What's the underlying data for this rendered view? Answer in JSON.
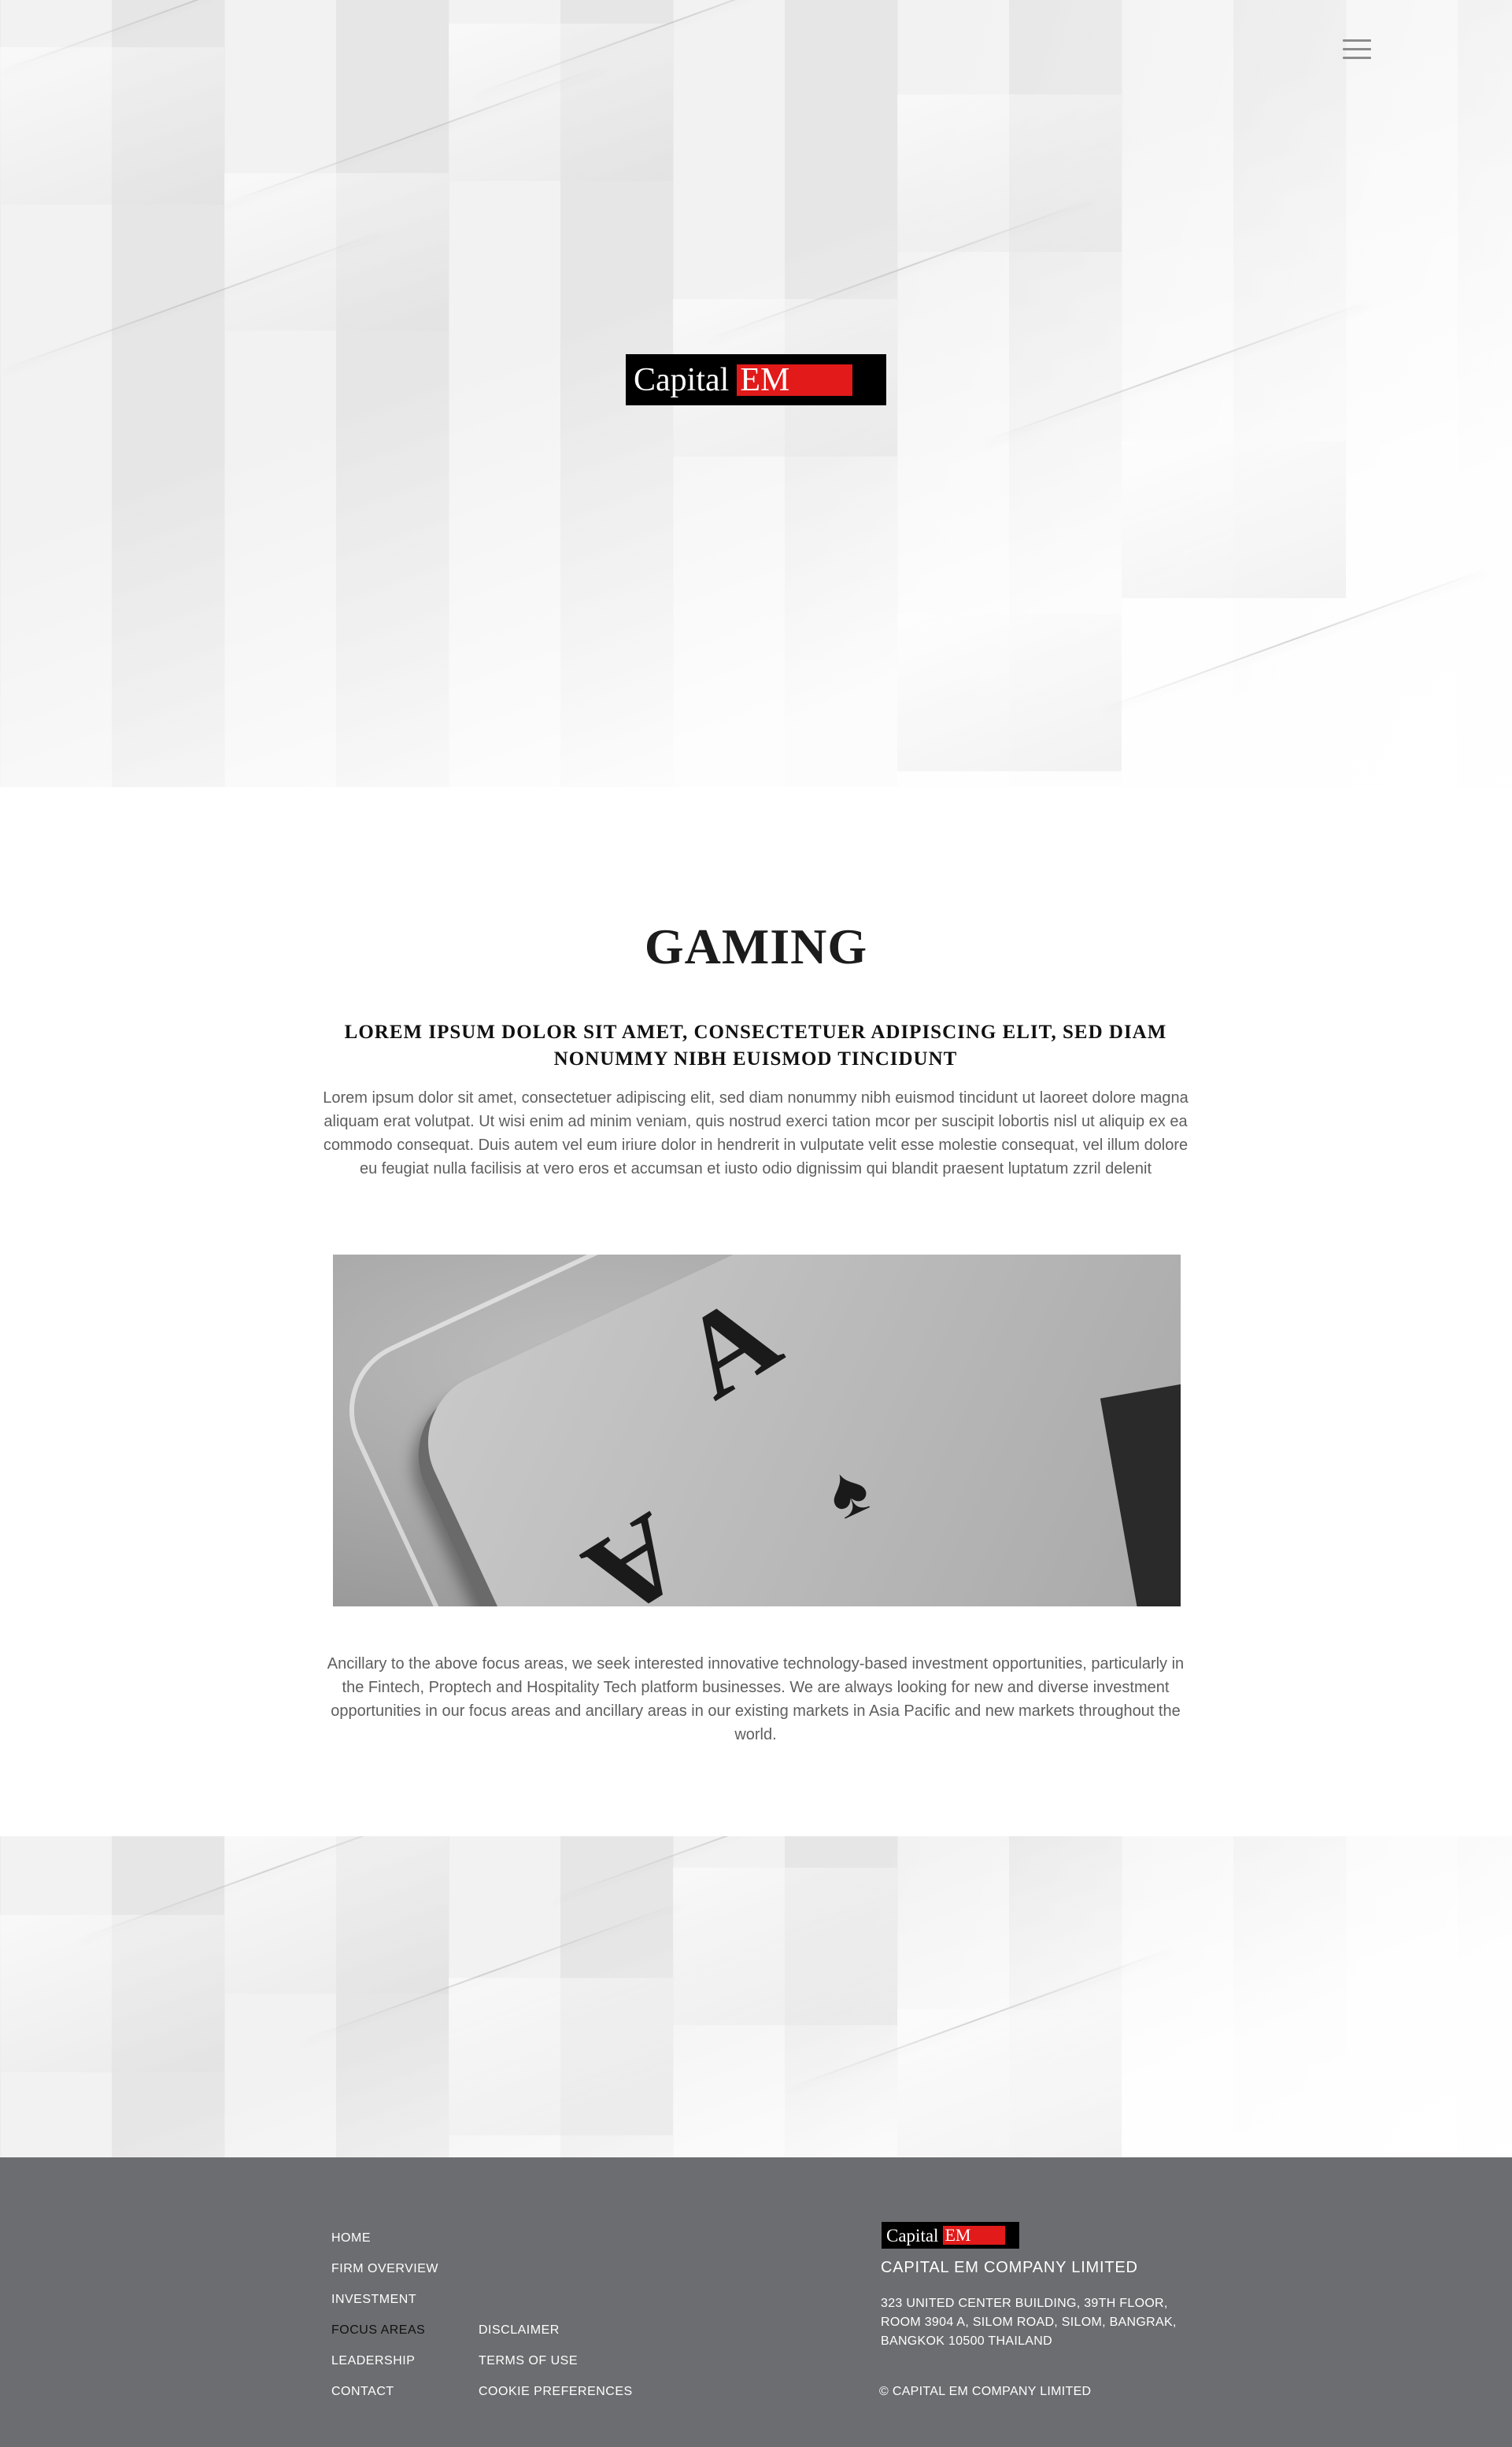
{
  "header": {
    "menu_icon": "hamburger-menu-icon",
    "logo": {
      "word1": "Capital",
      "word2": "EM"
    }
  },
  "main": {
    "title": "GAMING",
    "subheading": "LOREM IPSUM DOLOR SIT AMET, CONSECTETUER ADIPISCING ELIT, SED DIAM NONUMMY NIBH EUISMOD TINCIDUNT",
    "intro": "Lorem ipsum dolor sit amet, consectetuer adipiscing elit, sed diam nonummy nibh euismod tincidunt ut laoreet dolore magna aliquam erat volutpat. Ut wisi enim ad minim veniam, quis nostrud exerci tation mcor per suscipit lobortis nisl ut aliquip ex ea commodo consequat. Duis autem vel eum iriure dolor in hendrerit in vulputate velit esse molestie consequat, vel illum dolore eu feugiat nulla facilisis at vero eros et accumsan et iusto odio dignissim qui blandit praesent luptatum zzril delenit",
    "body": "Ancillary to the above focus areas, we seek interested innovative technology-based investment opportunities, particularly in the Fintech, Proptech and Hospitality Tech platform businesses. We are always looking for new and diverse investment opportunities in our focus areas and ancillary areas in our existing markets in Asia Pacific and new markets throughout the world.",
    "image": {
      "ace": "A",
      "spade": "♠"
    }
  },
  "footer": {
    "nav_col1": [
      "HOME",
      "FIRM OVERVIEW",
      "INVESTMENT",
      "FOCUS AREAS",
      "LEADERSHIP",
      "CONTACT"
    ],
    "nav_col2": [
      "DISCLAIMER",
      "TERMS OF USE",
      "COOKIE PREFERENCES"
    ],
    "active_item": "FOCUS AREAS",
    "logo": {
      "word1": "Capital",
      "word2": "EM"
    },
    "company_name": "CAPITAL EM COMPANY LIMITED",
    "address": "323 UNITED CENTER BUILDING, 39TH FLOOR, ROOM 3904 A, SILOM ROAD, SILOM, BANGRAK, BANGKOK 10500 THAILAND",
    "copyright": "© CAPITAL EM COMPANY LIMITED"
  },
  "colors": {
    "brand_red": "#e21a1a",
    "footer_bg": "#6c6d70",
    "heading": "#1c1c1c",
    "body_text": "#5e5e5e"
  }
}
